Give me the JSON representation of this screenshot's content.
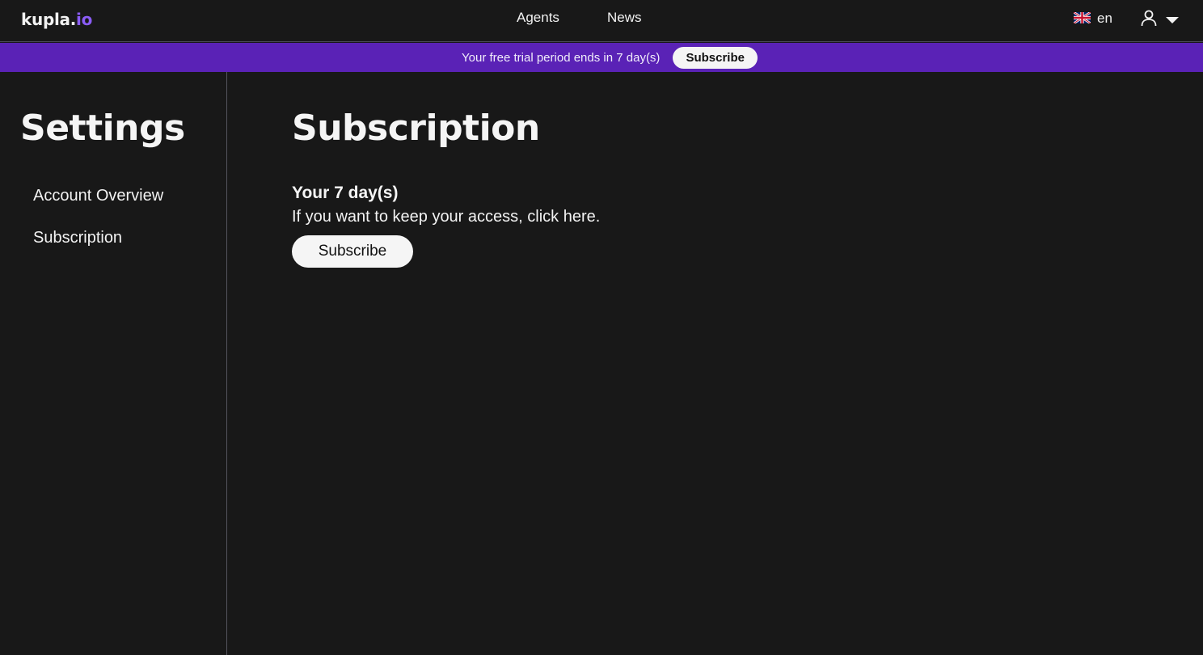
{
  "header": {
    "logo_main": "kupla.",
    "logo_accent": "io",
    "nav": [
      {
        "label": "Agents"
      },
      {
        "label": "News"
      }
    ],
    "language": {
      "icon": "uk-flag-icon",
      "label": "en"
    },
    "user_menu": {
      "icon": "user-icon",
      "dropdown_icon": "caret-down-icon"
    }
  },
  "banner": {
    "message": "Your free trial period ends in 7 day(s)",
    "button_label": "Subscribe",
    "background": "#5a22b6"
  },
  "sidebar": {
    "title": "Settings",
    "items": [
      {
        "label": "Account Overview"
      },
      {
        "label": "Subscription"
      }
    ]
  },
  "main": {
    "title": "Subscription",
    "days_heading": "Your 7 day(s)",
    "description": "If you want to keep your access, click here.",
    "button_label": "Subscribe"
  },
  "colors": {
    "background": "#181818",
    "accent": "#8a5cf5",
    "banner": "#5a22b6"
  }
}
